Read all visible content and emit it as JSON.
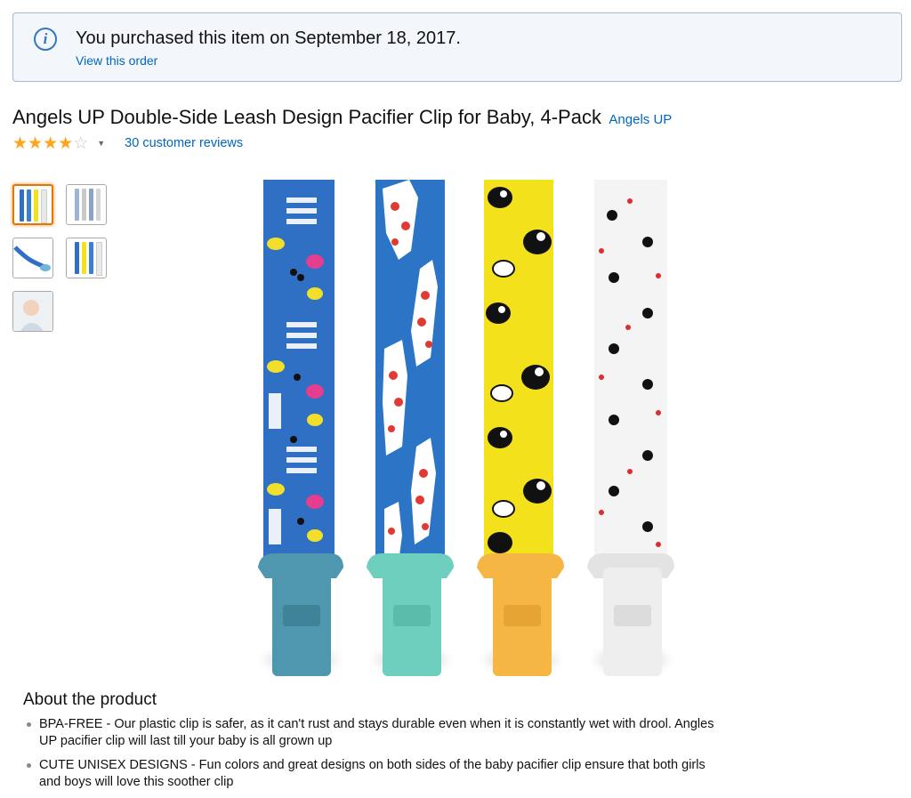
{
  "alert": {
    "icon": "info-icon",
    "icon_glyph": "i",
    "message": "You purchased this item on September 18, 2017.",
    "link": "View this order"
  },
  "product": {
    "title": "Angels UP Double-Side Leash Design Pacifier Clip for Baby, 4-Pack",
    "brand": "Angels UP",
    "rating": 4.0,
    "rating_max": 5,
    "reviews_link": "30 customer reviews"
  },
  "about": {
    "heading": "About the product",
    "bullets": [
      "BPA-FREE - Our plastic clip is safer, as it can't rust and stays durable even when it is constantly wet with drool. Angles UP pacifier clip will last till your baby is all grown up",
      "CUTE UNISEX DESIGNS - Fun colors and great designs on both sides of the baby pacifier clip ensure that both girls and boys will love this soother clip"
    ]
  },
  "colors": {
    "link": "#0066c0",
    "star": "#ffa41c",
    "selected_border": "#e77600",
    "strap_blue": "#2f6fc4",
    "strap_yellow": "#f3e21b",
    "strap_white": "#f4f4f4",
    "clip_teal": "#4e97ae",
    "clip_mint": "#6fcfbf",
    "clip_orange": "#f5b644",
    "clip_gray": "#e3e3e3"
  }
}
